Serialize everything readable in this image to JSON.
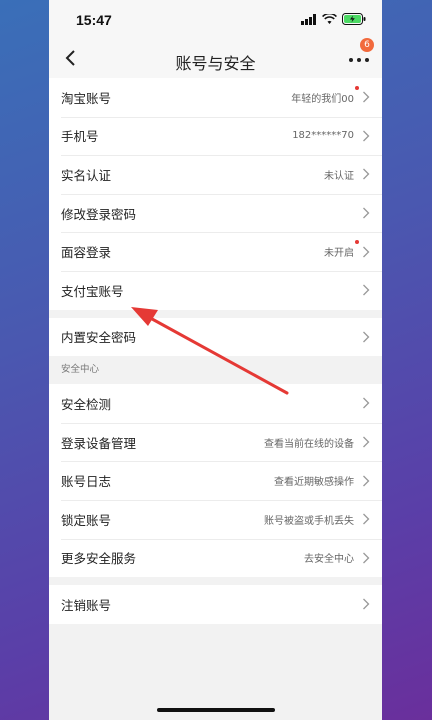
{
  "status_bar": {
    "time": "15:47"
  },
  "nav": {
    "title": "账号与安全",
    "badge": "6"
  },
  "group1": [
    {
      "label": "淘宝账号",
      "value": "年轻的我们00",
      "dot": true
    },
    {
      "label": "手机号",
      "value": "182******70",
      "dot": false
    },
    {
      "label": "实名认证",
      "value": "未认证",
      "dot": false
    },
    {
      "label": "修改登录密码",
      "value": "",
      "dot": false
    },
    {
      "label": "面容登录",
      "value": "未开启",
      "dot": true
    },
    {
      "label": "支付宝账号",
      "value": "",
      "dot": false
    }
  ],
  "group2": [
    {
      "label": "内置安全密码",
      "value": ""
    }
  ],
  "section_title": "安全中心",
  "group3": [
    {
      "label": "安全检测",
      "value": ""
    },
    {
      "label": "登录设备管理",
      "value": "查看当前在线的设备"
    },
    {
      "label": "账号日志",
      "value": "查看近期敏感操作"
    },
    {
      "label": "锁定账号",
      "value": "账号被盗或手机丢失"
    },
    {
      "label": "更多安全服务",
      "value": "去安全中心"
    }
  ],
  "group4": [
    {
      "label": "注销账号",
      "value": ""
    }
  ],
  "colors": {
    "badge": "#f26a3d",
    "dot": "#e53935",
    "arrow": "#e53935",
    "battery": "#4cd964"
  }
}
